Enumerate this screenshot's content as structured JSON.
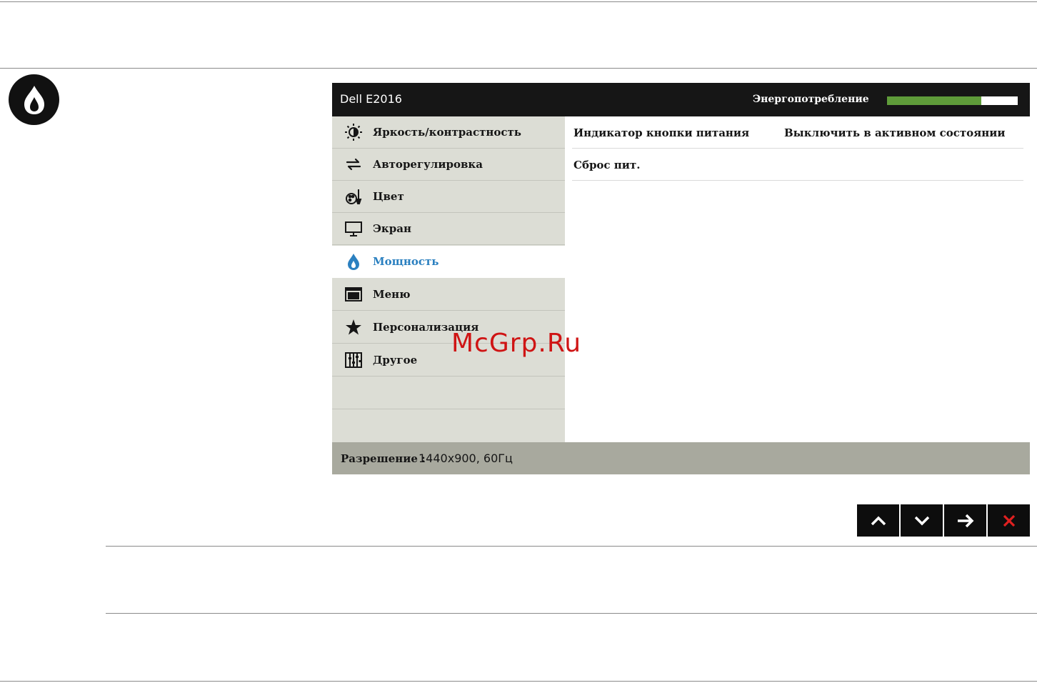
{
  "osd": {
    "title": "Dell E2016",
    "energy_label": "Энергопотребление",
    "energy_level_percent": 72,
    "menu": [
      {
        "label": "Яркость/контрастность",
        "icon": "brightness-icon"
      },
      {
        "label": "Авторегулировка",
        "icon": "auto-adjust-icon"
      },
      {
        "label": "Цвет",
        "icon": "color-icon"
      },
      {
        "label": "Экран",
        "icon": "display-icon"
      },
      {
        "label": "Мощность",
        "icon": "power-flame-icon",
        "active": true
      },
      {
        "label": "Меню",
        "icon": "menu-icon"
      },
      {
        "label": "Персонализация",
        "icon": "star-icon"
      },
      {
        "label": "Другое",
        "icon": "others-icon"
      }
    ],
    "content": {
      "rows": [
        {
          "label": "Индикатор кнопки питания",
          "value": "Выключить в активном состоянии"
        },
        {
          "label": "Сброс пит.",
          "value": ""
        }
      ]
    },
    "footer": {
      "label": "Разрешение :",
      "value": "1440x900, 60Гц"
    }
  },
  "nav_buttons": [
    {
      "icon": "up-arrow-icon"
    },
    {
      "icon": "down-arrow-icon"
    },
    {
      "icon": "right-arrow-icon"
    },
    {
      "icon": "close-icon",
      "color": "#e02020"
    }
  ],
  "badge_icon": "power-flame-icon",
  "watermark": "McGrp.Ru",
  "colors": {
    "header_bg": "#161616",
    "menu_bg": "#dcddd5",
    "active_text": "#2b80c0",
    "energy_bar": "#5f9c3a",
    "footer_bg": "#a8a99e"
  }
}
